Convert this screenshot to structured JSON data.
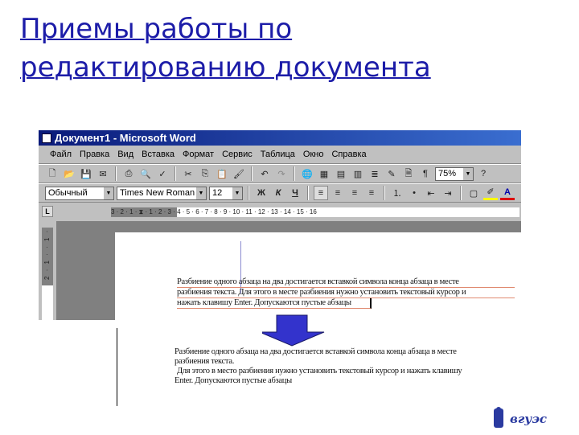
{
  "slide": {
    "title": "Приемы работы по редактированию документа"
  },
  "word": {
    "window_title": "Документ1 - Microsoft Word",
    "menu": [
      "Файл",
      "Правка",
      "Вид",
      "Вставка",
      "Формат",
      "Сервис",
      "Таблица",
      "Окно",
      "Справка"
    ],
    "zoom": "75%",
    "style": "Обычный",
    "font": "Times New Roman",
    "size": "12",
    "bold": "Ж",
    "italic": "К",
    "underline": "Ч",
    "ruler": "3 · 2 · 1 · ⧗ · 1 · 2 · 3 · 4 · 5 · 6 · 7 · 8 · 9 · 10 · 11 · 12 · 13 · 14 · 15 · 16",
    "ruler_v": "2 · 1 · · 1 ·",
    "before": [
      "Разбиение одного абзаца на два достигается вставкой символа конца абзаца в месте",
      "разбиения текста. Для этого в месте разбиения нужно установить текстовый курсор и",
      "нажать клавишу Enter. Допускаются пустые абзацы"
    ]
  },
  "after": [
    "Разбиение одного абзаца на два достигается вставкой символа конца абзаца в месте",
    "разбиения текста.",
    "Для этого в место разбиения нужно установить текстовый курсор и нажать клавишу",
    "Enter. Допускаются пустые абзацы"
  ],
  "logo": {
    "text": "ВГУЭС"
  },
  "colors": {
    "title": "#1c1ca8",
    "arrow": "#3333cc",
    "titlebar": "#0a1a7a"
  }
}
